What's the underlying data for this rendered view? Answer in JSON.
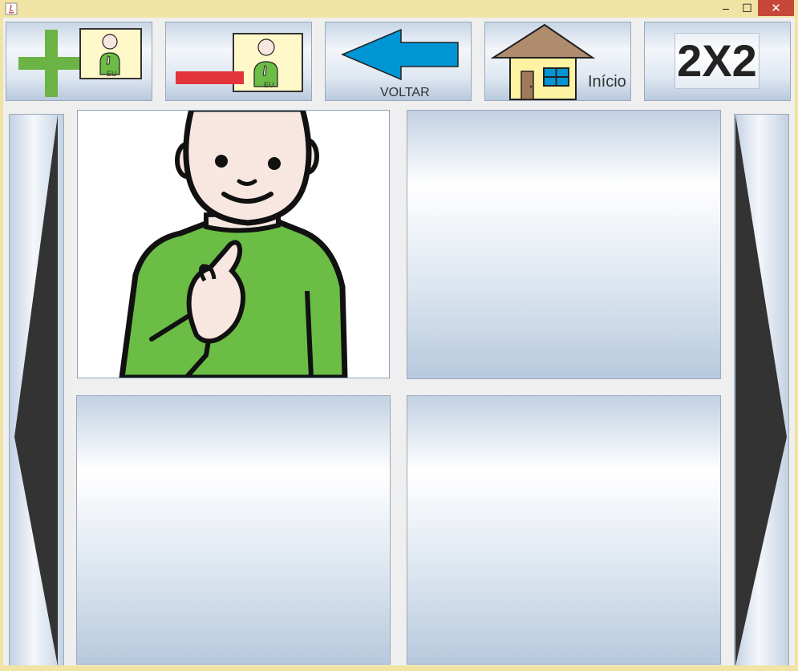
{
  "window": {
    "title": "",
    "minimize": "–",
    "maximize": "☐",
    "close": "✕"
  },
  "toolbar": {
    "add_caption": "EU",
    "remove_caption": "EU",
    "back_label": "VOLTAR",
    "home_label": "Início",
    "grid_label": "2X2"
  },
  "grid": {
    "size": "2X2",
    "cells": [
      {
        "position": "top-left",
        "pictogram": "person-pointing-to-self",
        "filled": true
      },
      {
        "position": "top-right",
        "filled": false
      },
      {
        "position": "bottom-left",
        "filled": false
      },
      {
        "position": "bottom-right",
        "filled": false
      }
    ]
  },
  "colors": {
    "title_bar": "#f0e3a4",
    "close_button": "#c7463a",
    "plus": "#6ab344",
    "minus": "#e2343a",
    "back_arrow": "#0096d6",
    "house_wall": "#fdf3a2",
    "house_roof": "#b08c6e",
    "shirt": "#6bbd45",
    "skin": "#f8e7e1"
  }
}
